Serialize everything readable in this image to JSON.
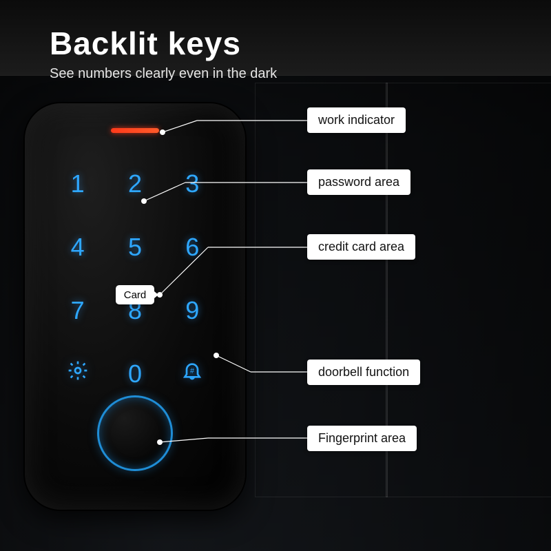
{
  "heading": {
    "title": "Backlit keys",
    "subtitle": "See numbers clearly even in the dark"
  },
  "keypad": {
    "keys": [
      "1",
      "2",
      "3",
      "4",
      "5",
      "6",
      "7",
      "8",
      "9",
      "",
      "0",
      ""
    ],
    "card_label": "Card"
  },
  "callouts": {
    "indicator": "work indicator",
    "password": "password area",
    "card": "credit card area",
    "doorbell": "doorbell function",
    "fingerprint": "Fingerprint area"
  },
  "icons": {
    "gear": "gear-icon",
    "bell": "bell-icon"
  }
}
